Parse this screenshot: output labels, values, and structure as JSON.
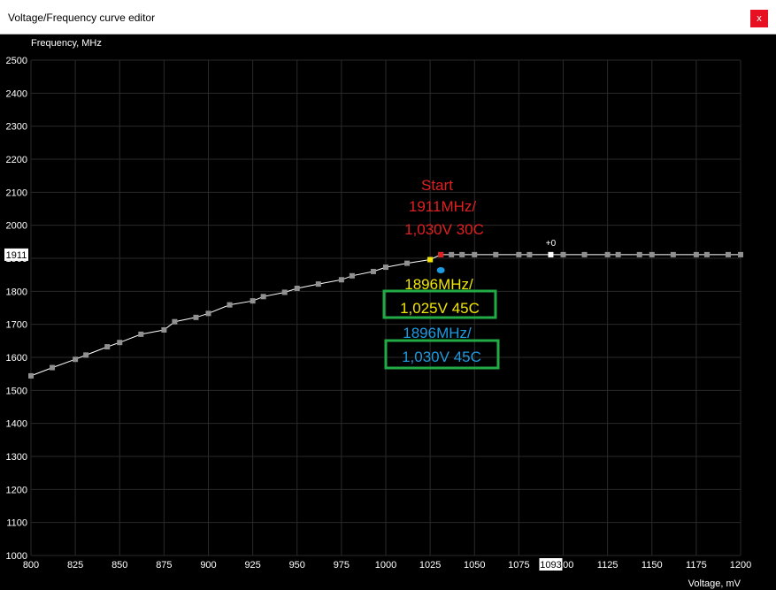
{
  "window": {
    "title": "Voltage/Frequency curve editor",
    "close_label": "x"
  },
  "colors": {
    "start": "#e02020",
    "yellow": "#f2e600",
    "blue": "#1e9be0",
    "box": "#22aa44",
    "curve": "#ffffff",
    "points": "#909090",
    "grid": "#2a2a2a"
  },
  "chart_data": {
    "type": "line",
    "title": "",
    "xlabel": "Voltage, mV",
    "ylabel": "Frequency, MHz",
    "xlim": [
      800,
      1200
    ],
    "ylim": [
      1000,
      2500
    ],
    "xticks": [
      800,
      825,
      850,
      875,
      900,
      925,
      950,
      975,
      1000,
      1025,
      1050,
      1075,
      1100,
      1125,
      1150,
      1175,
      1200
    ],
    "yticks": [
      1000,
      1100,
      1200,
      1300,
      1400,
      1500,
      1600,
      1700,
      1800,
      1900,
      2000,
      2100,
      2200,
      2300,
      2400,
      2500
    ],
    "grid": true,
    "series": [
      {
        "x": [
          800,
          812,
          825,
          831,
          843,
          850,
          862,
          875,
          881,
          893,
          900,
          912,
          925,
          931,
          943,
          950,
          962,
          975,
          981,
          993,
          1000,
          1012,
          1025,
          1031,
          1037,
          1043,
          1050,
          1062,
          1075,
          1081,
          1093,
          1100,
          1112,
          1125,
          1131,
          1143,
          1150,
          1162,
          1175,
          1181,
          1193,
          1200
        ],
        "y": [
          1544,
          1569,
          1594,
          1607,
          1632,
          1645,
          1670,
          1683,
          1708,
          1721,
          1733,
          1759,
          1771,
          1784,
          1797,
          1809,
          1822,
          1835,
          1847,
          1860,
          1873,
          1885,
          1896,
          1911,
          1911,
          1911,
          1911,
          1911,
          1911,
          1911,
          1911,
          1911,
          1911,
          1911,
          1911,
          1911,
          1911,
          1911,
          1911,
          1911,
          1911,
          1911
        ]
      }
    ],
    "cursor_value_y": "1911",
    "cursor_value_x": "1093",
    "offset_label": "+0",
    "markers": {
      "start": {
        "x": 1031,
        "y": 1911
      },
      "yellow": {
        "x": 1025,
        "y": 1896
      },
      "blue": {
        "x": 1031,
        "y": 1896
      },
      "offset": {
        "x": 1093,
        "y": 1911
      }
    },
    "annotations": {
      "start": [
        "Start",
        "1911MHz/",
        "1,030V 30C"
      ],
      "yellow": [
        "1896MHz/",
        "1,025V 45C"
      ],
      "blue": [
        "1896MHz/",
        "1,030V 45C"
      ]
    }
  }
}
